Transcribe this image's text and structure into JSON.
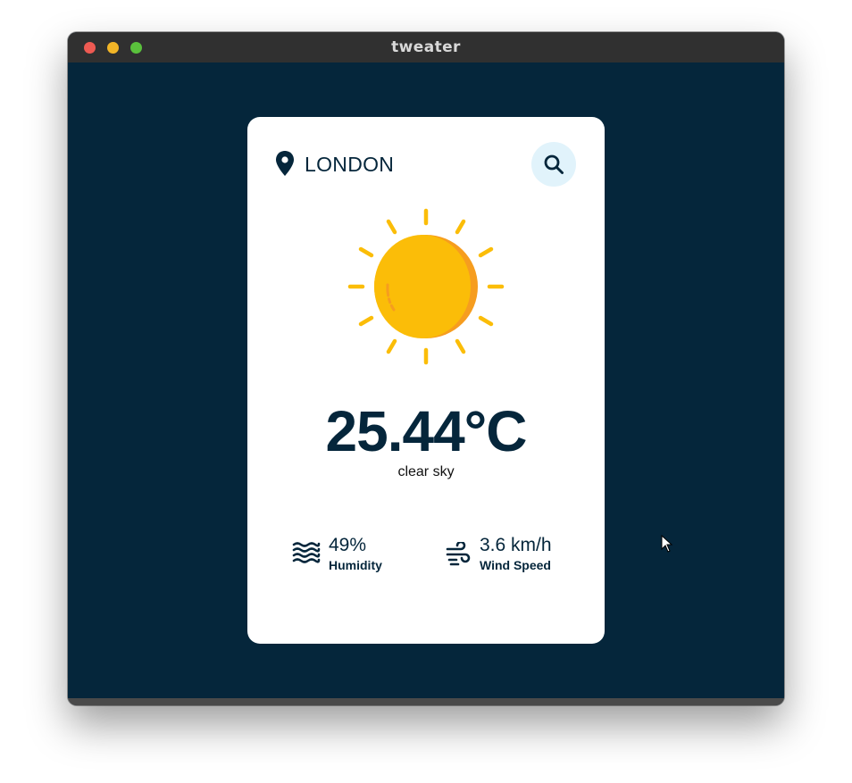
{
  "window": {
    "title": "tweater"
  },
  "location": {
    "name": "LONDON",
    "icon": "map-pin-icon"
  },
  "search": {
    "icon": "search-icon"
  },
  "weather": {
    "icon": "sun-icon",
    "temperature": "25.44°C",
    "description": "clear sky"
  },
  "stats": {
    "humidity": {
      "value": "49%",
      "label": "Humidity",
      "icon": "humidity-waves-icon"
    },
    "wind": {
      "value": "3.6 km/h",
      "label": "Wind Speed",
      "icon": "wind-icon"
    }
  },
  "colors": {
    "background": "#05263b",
    "card": "#ffffff",
    "text_primary": "#05263b",
    "search_bg": "#e1f3fb",
    "sun_main": "#fbbd08",
    "sun_shade": "#f69d1f"
  }
}
